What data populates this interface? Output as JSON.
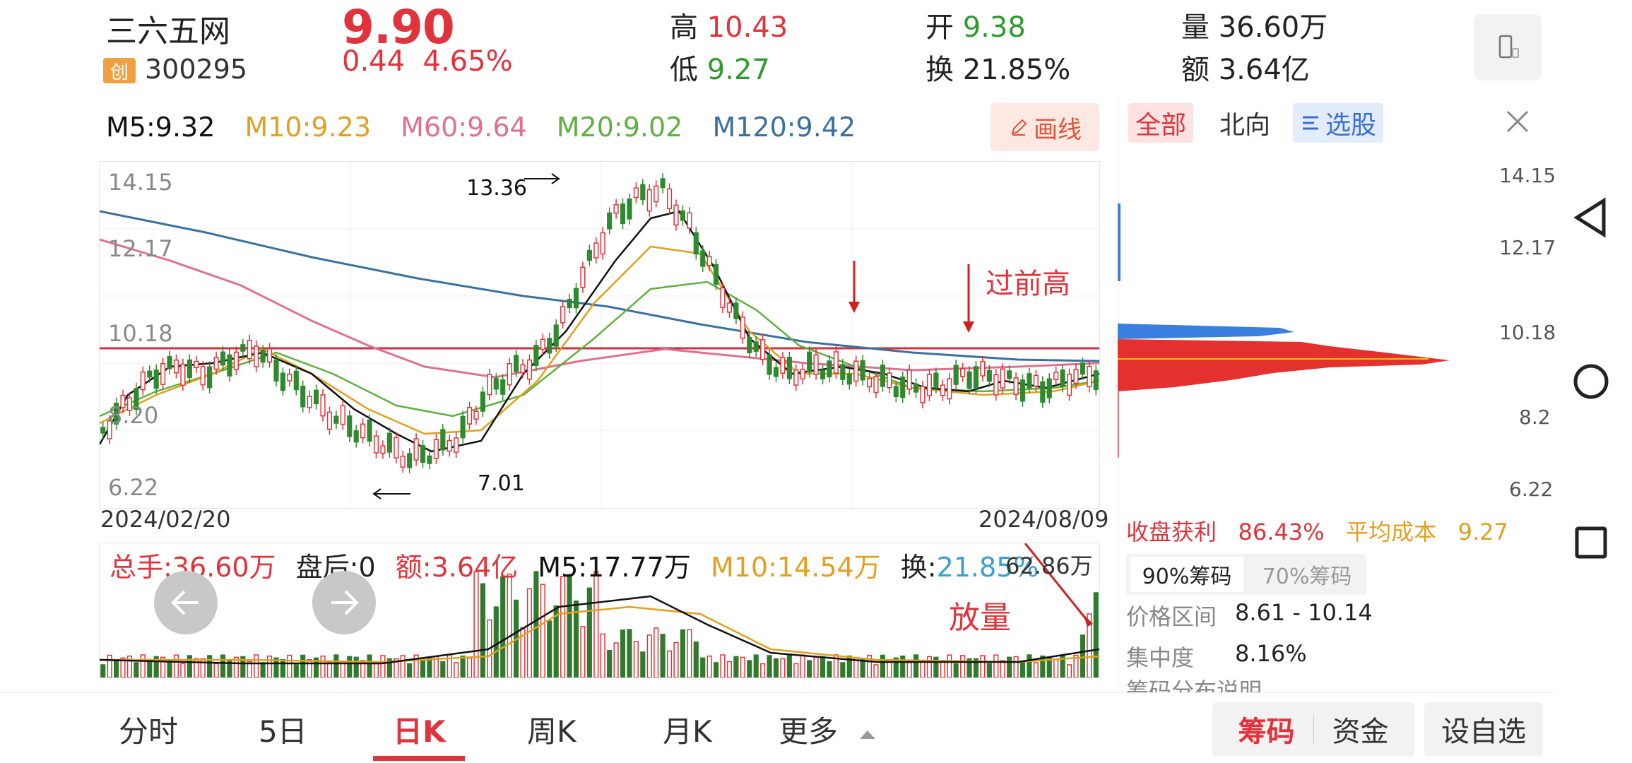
{
  "header": {
    "stock_name": "三六五网",
    "board_badge": "创",
    "stock_code": "300295",
    "price": "9.90",
    "change": "0.44",
    "change_pct": "4.65%",
    "stats": [
      {
        "label": "高",
        "value": "10.43",
        "tone": "up"
      },
      {
        "label": "低",
        "value": "9.27",
        "tone": "down"
      },
      {
        "label": "开",
        "value": "9.38",
        "tone": "down"
      },
      {
        "label": "换",
        "value": "21.85%",
        "tone": "neutral"
      },
      {
        "label": "量",
        "value": "36.60万",
        "tone": "neutral"
      },
      {
        "label": "额",
        "value": "3.64亿",
        "tone": "neutral"
      }
    ],
    "phone_icon": "phone-landscape-icon"
  },
  "ma_legend": [
    {
      "label": "M5:9.32",
      "color": "#111111"
    },
    {
      "label": "M10:9.23",
      "color": "#e0a020"
    },
    {
      "label": "M60:9.64",
      "color": "#e07090"
    },
    {
      "label": "M20:9.02",
      "color": "#60b040"
    },
    {
      "label": "M120:9.42",
      "color": "#3a70a0"
    }
  ],
  "draw_button": "画线",
  "kline": {
    "y_labels": [
      "14.15",
      "12.17",
      "10.18",
      "8.20",
      "6.22"
    ],
    "start_date": "2024/02/20",
    "end_date": "2024/08/09",
    "high_marker": "13.36",
    "low_marker": "7.01",
    "annotation_prev_high": "过前高"
  },
  "volume": {
    "total": "总手:36.60万",
    "after_hours": "盘后:0",
    "amount": "额:3.64亿",
    "m5": "M5:17.77万",
    "m10": "M10:14.54万",
    "turnover_label": "换:",
    "turnover_value": "21.85%",
    "max_label": "62.86万",
    "annotation_volume": "放量"
  },
  "right_panel": {
    "tabs": [
      "全部",
      "北向",
      "选股"
    ],
    "y_labels": [
      "14.15",
      "12.17",
      "10.18",
      "8.2",
      "6.22"
    ],
    "profit_label": "收盘获利",
    "profit_value": "86.43%",
    "avg_cost_label": "平均成本",
    "avg_cost_value": "9.27",
    "chip_tabs": [
      "90%筹码",
      "70%筹码"
    ],
    "price_range_label": "价格区间",
    "price_range_value": "8.61 - 10.14",
    "concentration_label": "集中度",
    "concentration_value": "8.16%",
    "explain": "筹码分布说明"
  },
  "bottom_tabs": [
    "分时",
    "5日",
    "日K",
    "周K",
    "月K",
    "更多"
  ],
  "bottom_actions": [
    "筹码",
    "资金",
    "设自选"
  ],
  "colors": {
    "up": "#e0333b",
    "down": "#2f9a2f",
    "accent": "#e0333b"
  }
}
